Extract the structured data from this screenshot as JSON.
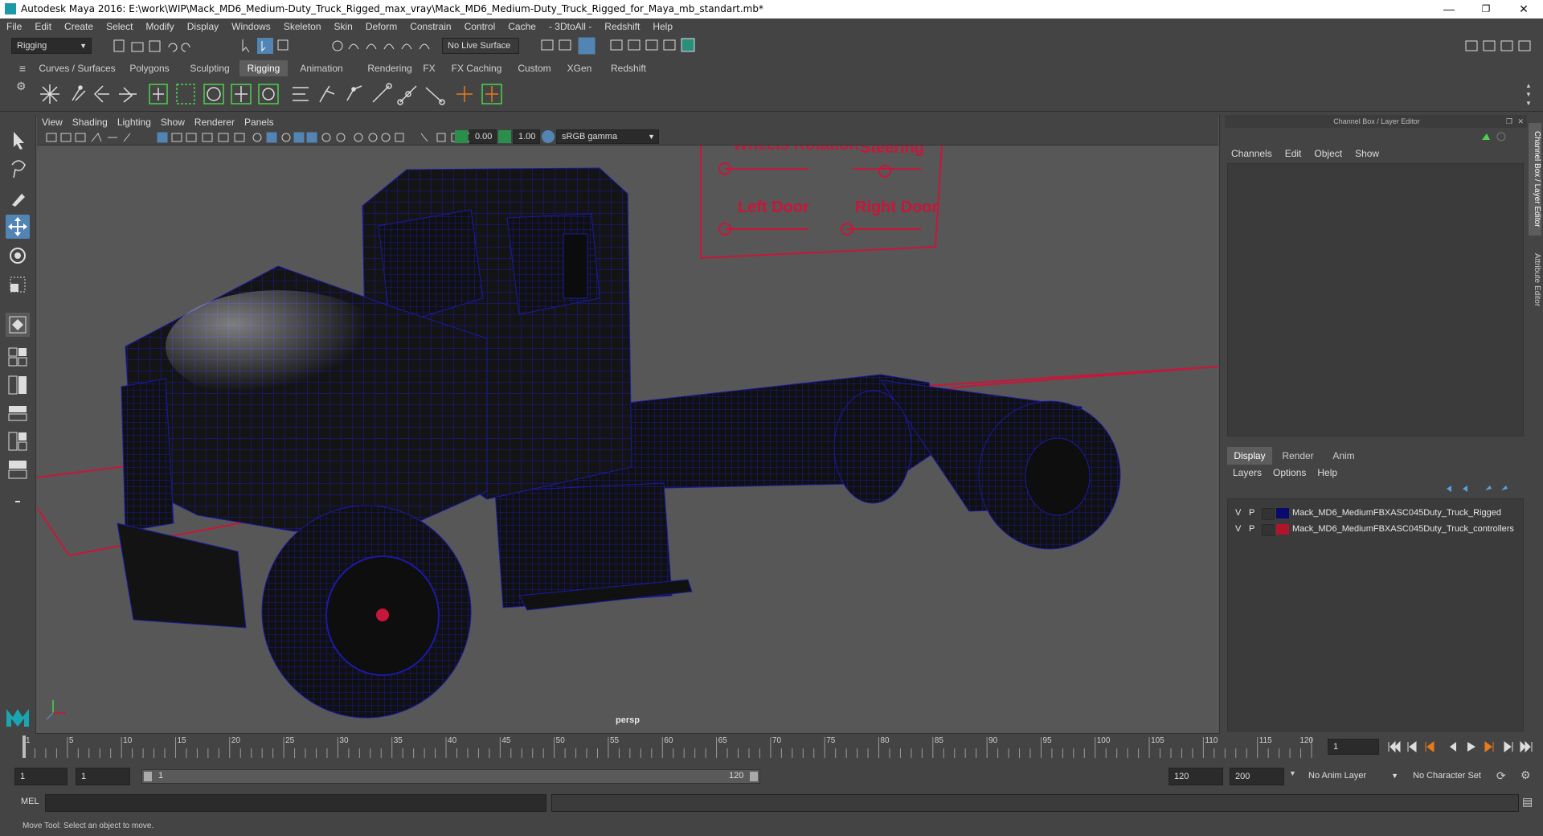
{
  "window": {
    "title": "Autodesk Maya 2016: E:\\work\\WIP\\Mack_MD6_Medium-Duty_Truck_Rigged_max_vray\\Mack_MD6_Medium-Duty_Truck_Rigged_for_Maya_mb_standart.mb*",
    "minimize": "—",
    "restore": "❐",
    "close": "✕"
  },
  "menubar": [
    "File",
    "Edit",
    "Create",
    "Select",
    "Modify",
    "Display",
    "Windows",
    "Skeleton",
    "Skin",
    "Deform",
    "Constrain",
    "Control",
    "Cache",
    "- 3DtoAll -",
    "Redshift",
    "Help"
  ],
  "status_line": {
    "menu_set": "Rigging",
    "live_surface": "No Live Surface"
  },
  "shelf_tabs": [
    "Curves / Surfaces",
    "Polygons",
    "Sculpting",
    "Rigging",
    "Animation",
    "Rendering",
    "FX",
    "FX Caching",
    "Custom",
    "XGen",
    "Redshift"
  ],
  "active_shelf_tab": "Rigging",
  "viewport": {
    "menu": [
      "View",
      "Shading",
      "Lighting",
      "Show",
      "Renderer",
      "Panels"
    ],
    "exposure": "0.00",
    "gamma": "1.00",
    "color_space": "sRGB gamma",
    "camera_label": "persp",
    "controller_board": {
      "labels": [
        "Wheels Rotation",
        "Steering",
        "Left Door",
        "Right Door"
      ]
    }
  },
  "channel_box": {
    "header": "Channel Box / Layer Editor",
    "menu": [
      "Channels",
      "Edit",
      "Object",
      "Show"
    ]
  },
  "layer_editor": {
    "tabs": [
      "Display",
      "Render",
      "Anim"
    ],
    "active_tab": "Display",
    "menu": [
      "Layers",
      "Options",
      "Help"
    ],
    "layers": [
      {
        "v": "V",
        "p": "P",
        "name": "Mack_MD6_MediumFBXASC045Duty_Truck_Rigged",
        "color": "#0a0a6e"
      },
      {
        "v": "V",
        "p": "P",
        "name": "Mack_MD6_MediumFBXASC045Duty_Truck_controllers",
        "color": "#b0142a"
      }
    ]
  },
  "side_tabs": [
    "Channel Box / Layer Editor",
    "Attribute Editor"
  ],
  "timeline": {
    "ticks": [
      "1",
      "5",
      "10",
      "15",
      "20",
      "25",
      "30",
      "35",
      "40",
      "45",
      "50",
      "55",
      "60",
      "65",
      "70",
      "75",
      "80",
      "85",
      "90",
      "95",
      "100",
      "105",
      "110",
      "115",
      "120"
    ],
    "current_frame": "1"
  },
  "range": {
    "start": "1",
    "playback_start": "1",
    "slider_start": "1",
    "slider_end": "120",
    "playback_end": "120",
    "end": "200",
    "anim_layer": "No Anim Layer",
    "character_set": "No Character Set"
  },
  "command_line": {
    "label": "MEL"
  },
  "help_line": {
    "text": "Move Tool: Select an object to move."
  },
  "colors": {
    "ui_bg": "#444444",
    "viewport_bg": "#575757",
    "wireframe": "#1a1aa8",
    "controller": "#c8163a",
    "active_tool": "#5284b4"
  }
}
